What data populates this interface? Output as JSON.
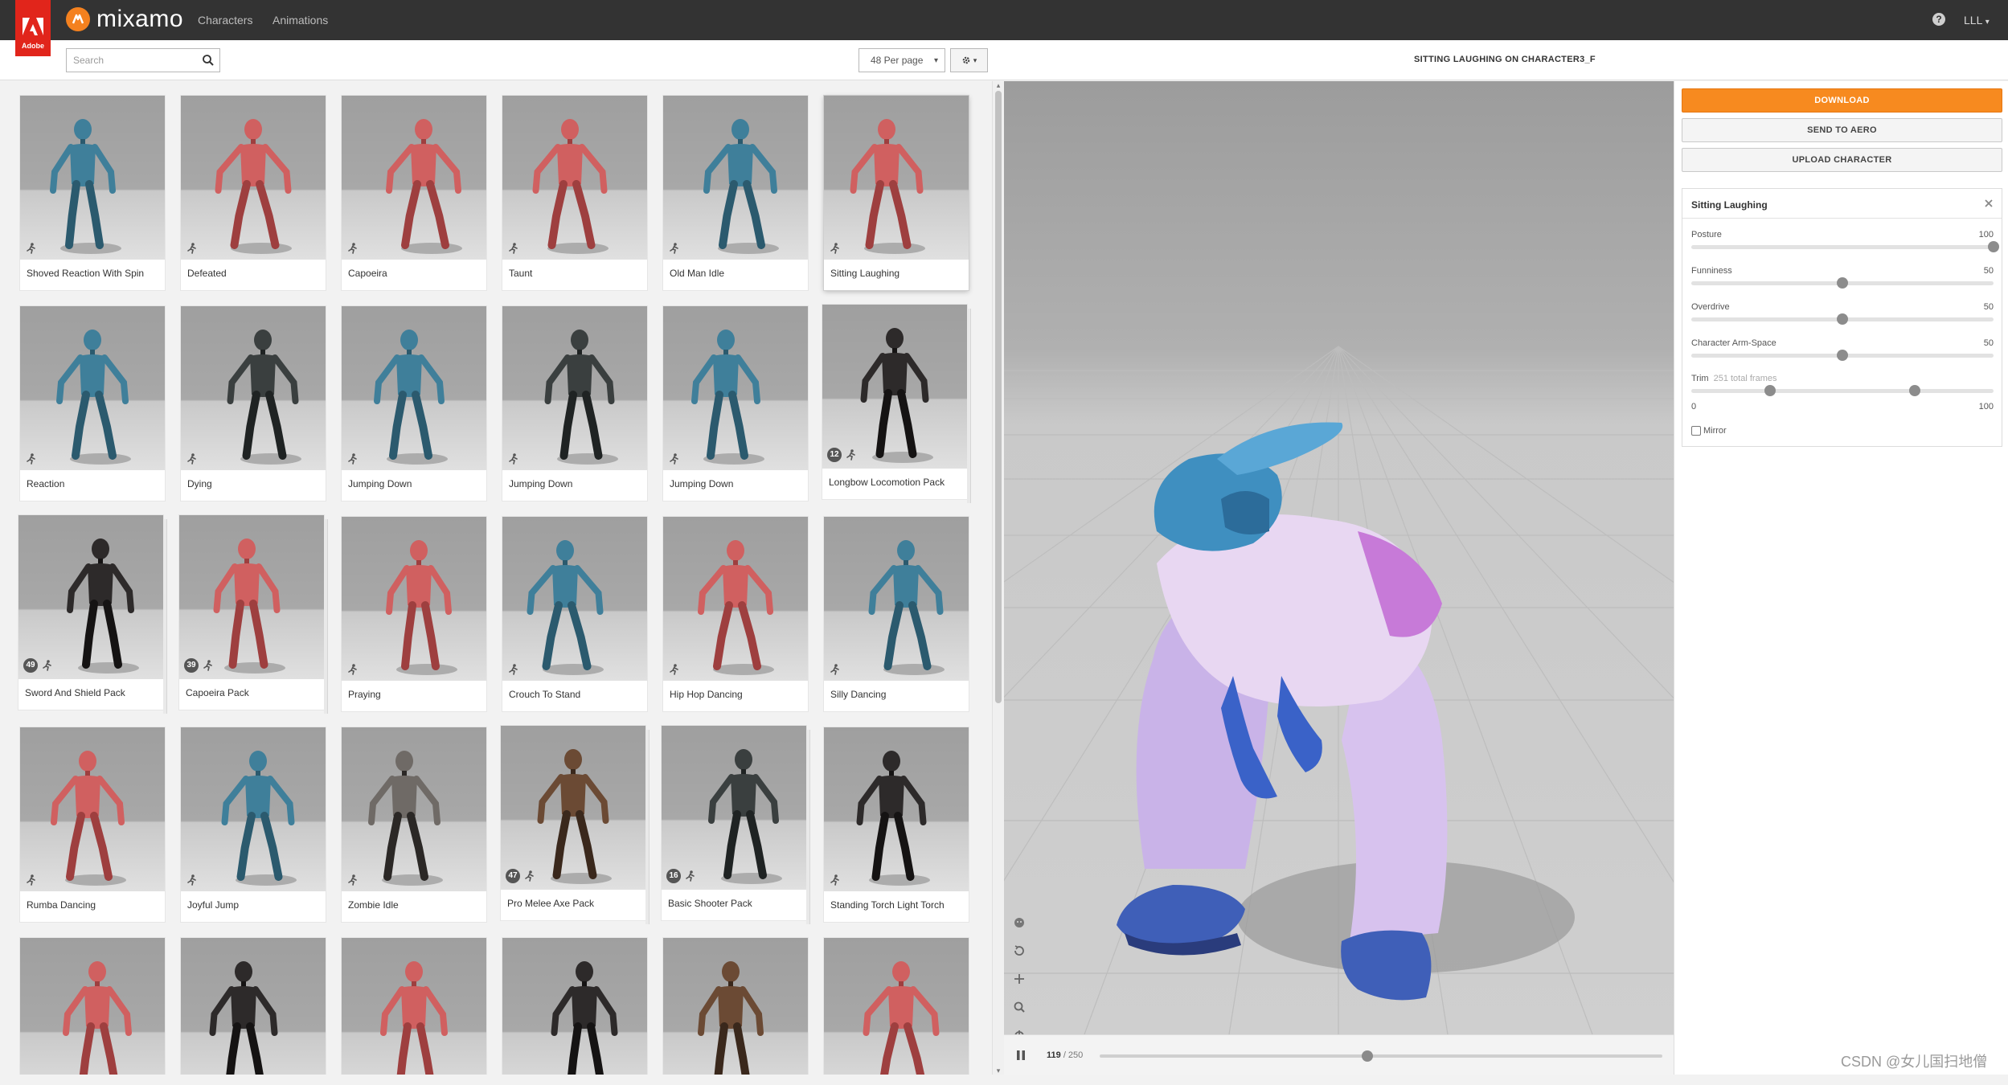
{
  "header": {
    "adobe_word": "Adobe",
    "brand": "mixamo",
    "nav": [
      {
        "label": "Characters"
      },
      {
        "label": "Animations"
      }
    ],
    "user": "LLL"
  },
  "toolbar": {
    "search_placeholder": "Search",
    "per_page": "48 Per page"
  },
  "grid": {
    "cards": [
      {
        "label": "Shoved Reaction With Spin",
        "figure": "blue",
        "pack": false
      },
      {
        "label": "Defeated",
        "figure": "red",
        "pack": false
      },
      {
        "label": "Capoeira",
        "figure": "red",
        "pack": false
      },
      {
        "label": "Taunt",
        "figure": "red",
        "pack": false
      },
      {
        "label": "Old Man Idle",
        "figure": "blue",
        "pack": false
      },
      {
        "label": "Sitting Laughing",
        "figure": "red",
        "pack": false,
        "selected": true
      },
      {
        "label": "Reaction",
        "figure": "blue",
        "pack": false
      },
      {
        "label": "Dying",
        "figure": "soldier",
        "pack": false
      },
      {
        "label": "Jumping Down",
        "figure": "blue",
        "pack": false
      },
      {
        "label": "Jumping Down",
        "figure": "soldier",
        "pack": false
      },
      {
        "label": "Jumping Down",
        "figure": "blue",
        "pack": false
      },
      {
        "label": "Longbow Locomotion Pack",
        "figure": "dark",
        "pack": true,
        "count": "12"
      },
      {
        "label": "Sword And Shield Pack",
        "figure": "dark",
        "pack": true,
        "count": "49"
      },
      {
        "label": "Capoeira Pack",
        "figure": "red",
        "pack": true,
        "count": "39"
      },
      {
        "label": "Praying",
        "figure": "red",
        "pack": false
      },
      {
        "label": "Crouch To Stand",
        "figure": "blue",
        "pack": false
      },
      {
        "label": "Hip Hop Dancing",
        "figure": "red",
        "pack": false
      },
      {
        "label": "Silly Dancing",
        "figure": "blue",
        "pack": false
      },
      {
        "label": "Rumba Dancing",
        "figure": "red",
        "pack": false
      },
      {
        "label": "Joyful Jump",
        "figure": "blue",
        "pack": false
      },
      {
        "label": "Zombie Idle",
        "figure": "zombie",
        "pack": false
      },
      {
        "label": "Pro Melee Axe Pack",
        "figure": "brown",
        "pack": true,
        "count": "47"
      },
      {
        "label": "Basic Shooter Pack",
        "figure": "soldier",
        "pack": true,
        "count": "16"
      },
      {
        "label": "Standing Torch Light Torch",
        "figure": "dark",
        "pack": false
      },
      {
        "label": "",
        "figure": "red",
        "pack": false
      },
      {
        "label": "",
        "figure": "dark",
        "pack": false
      },
      {
        "label": "",
        "figure": "red",
        "pack": false
      },
      {
        "label": "",
        "figure": "dark",
        "pack": false
      },
      {
        "label": "",
        "figure": "brown",
        "pack": false
      },
      {
        "label": "",
        "figure": "red",
        "pack": false
      }
    ]
  },
  "viewer": {
    "title": "SITTING LAUGHING ON CHARACTER3_F",
    "current_frame": "119",
    "total_frames": "/ 250",
    "progress": 0.476
  },
  "panel": {
    "download": "DOWNLOAD",
    "send_to_aero": "SEND TO AERO",
    "upload_character": "UPLOAD CHARACTER",
    "animation_name": "Sitting Laughing",
    "sliders": [
      {
        "label": "Posture",
        "value": "100",
        "fraction": 1.0
      },
      {
        "label": "Funniness",
        "value": "50",
        "fraction": 0.5
      },
      {
        "label": "Overdrive",
        "value": "50",
        "fraction": 0.5
      },
      {
        "label": "Character Arm-Space",
        "value": "50",
        "fraction": 0.5
      }
    ],
    "trim": {
      "label": "Trim",
      "sub": "251 total frames",
      "start_fraction": 0.26,
      "end_fraction": 0.74,
      "min": "0",
      "max": "100"
    },
    "mirror": "Mirror"
  },
  "colors": {
    "accent": "#f78a1f",
    "topbar": "#333333",
    "adobe_red": "#e1251b"
  },
  "watermark": "CSDN @女儿国扫地僧"
}
